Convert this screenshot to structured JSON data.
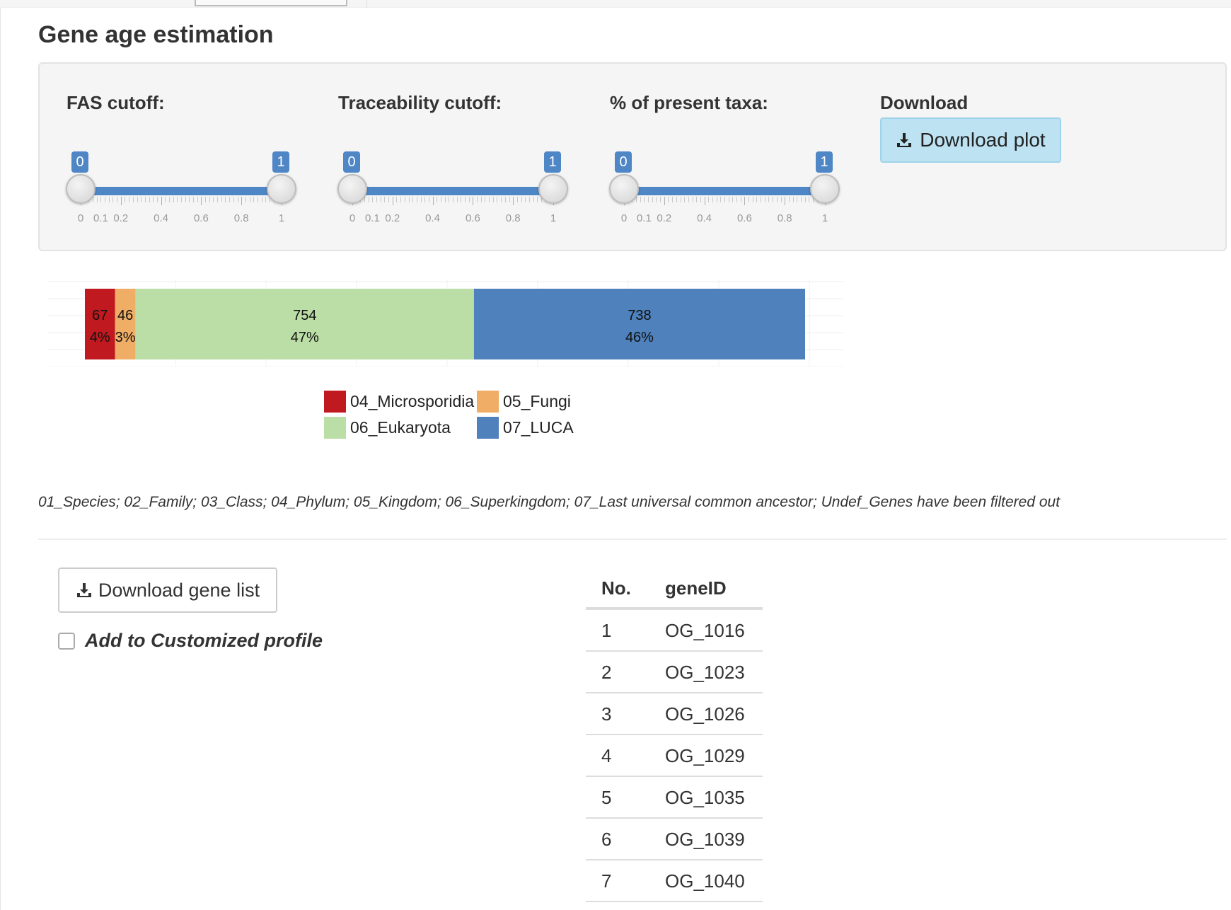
{
  "page": {
    "title": "Gene age estimation"
  },
  "sliders": [
    {
      "label": "FAS cutoff:",
      "min_label": "0",
      "max_label": "1",
      "low": 0,
      "high": 1,
      "tick_labels": [
        "0",
        "0.1",
        "0.2",
        "0.4",
        "0.6",
        "0.8",
        "1"
      ]
    },
    {
      "label": "Traceability cutoff:",
      "min_label": "0",
      "max_label": "1",
      "low": 0,
      "high": 1,
      "tick_labels": [
        "0",
        "0.1",
        "0.2",
        "0.4",
        "0.6",
        "0.8",
        "1"
      ]
    },
    {
      "label": "% of present taxa:",
      "min_label": "0",
      "max_label": "1",
      "low": 0,
      "high": 1,
      "tick_labels": [
        "0",
        "0.1",
        "0.2",
        "0.4",
        "0.6",
        "0.8",
        "1"
      ]
    }
  ],
  "download": {
    "label": "Download",
    "plot_button": "Download plot",
    "gene_list_button": "Download gene list"
  },
  "checkbox": {
    "label": "Add to Customized profile",
    "checked": false
  },
  "chart_data": {
    "type": "bar",
    "orientation": "horizontal-stacked",
    "categories": [
      "04_Microsporidia",
      "05_Fungi",
      "06_Eukaryota",
      "07_LUCA"
    ],
    "values": [
      67,
      46,
      754,
      738
    ],
    "percent_labels": [
      "4%",
      "3%",
      "47%",
      "46%"
    ],
    "colors": [
      "#c0191f",
      "#efad65",
      "#bbdea6",
      "#4f81bc"
    ],
    "legend_position": "bottom",
    "grid": true
  },
  "footnote": "01_Species; 02_Family; 03_Class; 04_Phylum; 05_Kingdom; 06_Superkingdom; 07_Last universal common ancestor; Undef_Genes have been filtered out",
  "table": {
    "headers": [
      "No.",
      "geneID"
    ],
    "rows": [
      [
        "1",
        "OG_1016"
      ],
      [
        "2",
        "OG_1023"
      ],
      [
        "3",
        "OG_1026"
      ],
      [
        "4",
        "OG_1029"
      ],
      [
        "5",
        "OG_1035"
      ],
      [
        "6",
        "OG_1039"
      ],
      [
        "7",
        "OG_1040"
      ]
    ]
  }
}
